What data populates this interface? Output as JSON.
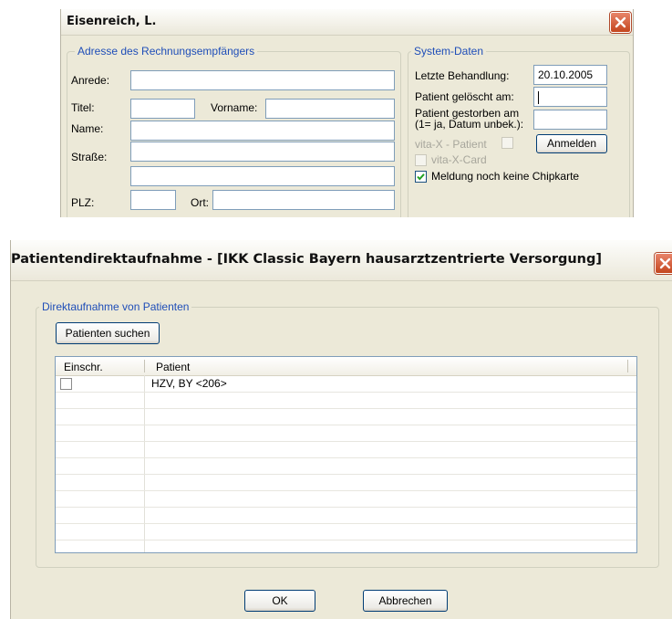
{
  "patient_dialog": {
    "title": "Eisenreich, L.",
    "address_group": {
      "label": "Adresse des Rechnungsempfängers",
      "anrede_label": "Anrede:",
      "anrede_value": "",
      "titel_label": "Titel:",
      "titel_value": "",
      "vorname_label": "Vorname:",
      "vorname_value": "",
      "name_label": "Name:",
      "name_value": "",
      "strasse_label": "Straße:",
      "strasse_value": "",
      "strasse2_value": "",
      "plz_label": "PLZ:",
      "plz_value": "",
      "ort_label": "Ort:",
      "ort_value": ""
    },
    "system_group": {
      "label": "System-Daten",
      "letzte_behandlung_label": "Letzte Behandlung:",
      "letzte_behandlung_value": "20.10.2005",
      "geloescht_label": "Patient gelöscht am:",
      "geloescht_value": "",
      "gestorben_label_line1": "Patient gestorben am",
      "gestorben_label_line2": "(1= ja, Datum unbek.):",
      "gestorben_value": "",
      "vitax_patient_label": "vita-X - Patient",
      "vitax_card_label": "vita-X-Card",
      "anmelden_button": "Anmelden",
      "meldung_label": "Meldung noch keine Chipkarte",
      "meldung_checked": true
    }
  },
  "direct_dialog": {
    "title": "Patientendirektaufnahme - [IKK Classic Bayern hausarztzentrierte Versorgung]",
    "group_label": "Direktaufnahme von Patienten",
    "search_button": "Patienten suchen",
    "columns": [
      "Einschr.",
      "Patient"
    ],
    "rows": [
      {
        "checked": false,
        "patient": "HZV, BY <206>"
      }
    ],
    "ok_button": "OK",
    "cancel_button": "Abbrechen"
  },
  "icons": {
    "close": "close-x-icon",
    "check": "checkmark-icon"
  },
  "colors": {
    "dialog_bg": "#ece9d8",
    "group_label": "#1f4eb8",
    "close_button": "#c4461e",
    "field_border": "#7f9db9",
    "disabled_text": "#a7a69c"
  }
}
